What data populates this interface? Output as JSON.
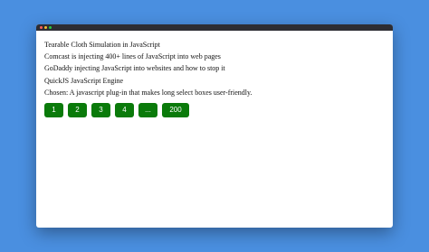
{
  "colors": {
    "background": "#4a8fe0",
    "window": "#ffffff",
    "titlebar": "#2d2d33",
    "button": "#0a7a0a",
    "button_text": "#ffffff"
  },
  "list": {
    "items": [
      "Tearable Cloth Simulation in JavaScript",
      "Comcast is injecting 400+ lines of JavaScript into web pages",
      "GoDaddy injecting JavaScript into websites and how to stop it",
      "QuickJS JavaScript Engine"
    ],
    "chosen": "Chosen: A javascript plug-in that makes long select boxes user-friendly."
  },
  "pagination": {
    "pages": [
      "1",
      "2",
      "3",
      "4",
      "...",
      "200"
    ]
  }
}
